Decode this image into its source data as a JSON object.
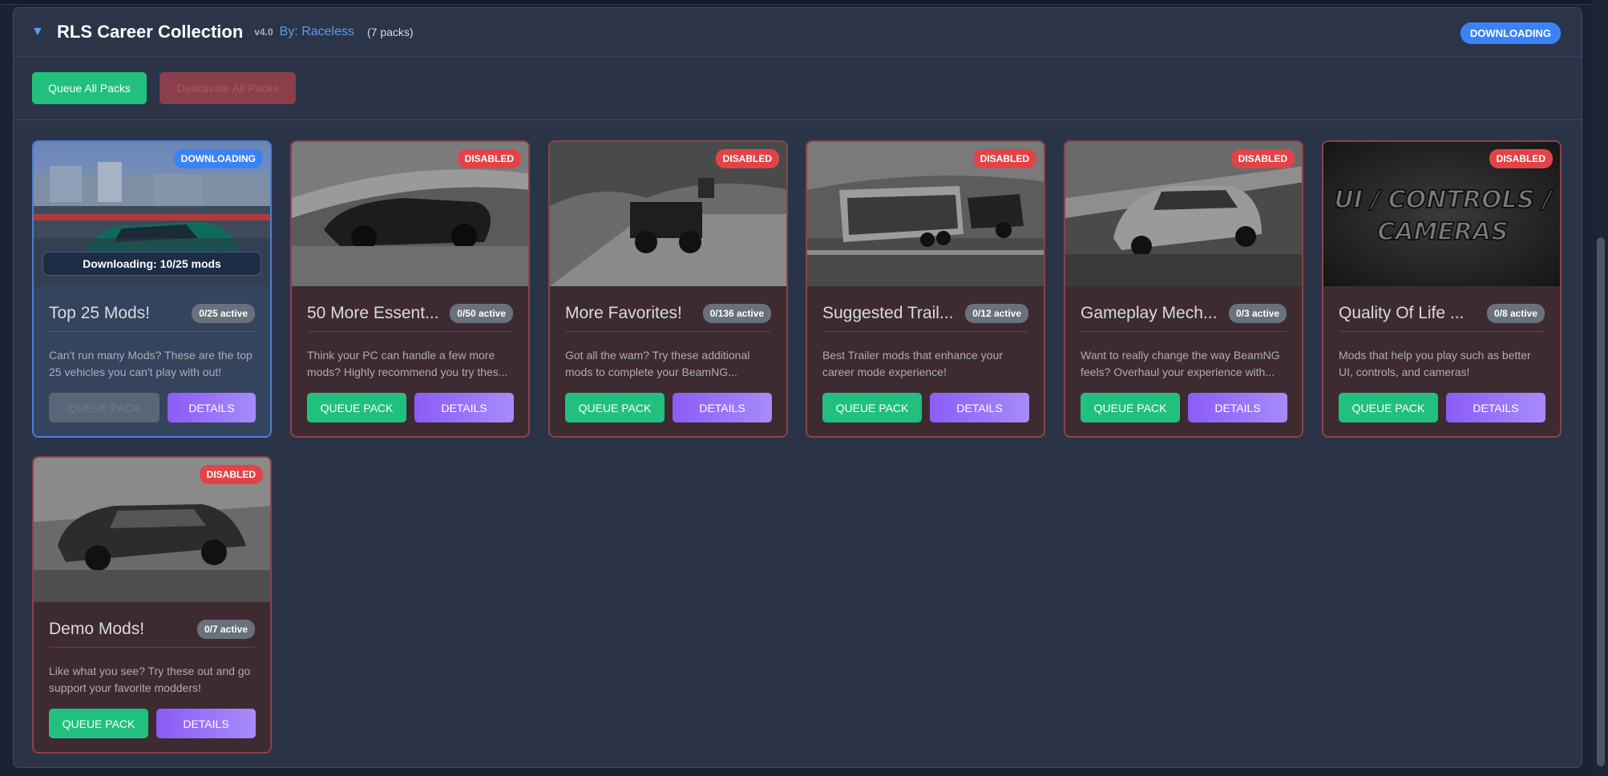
{
  "collection": {
    "title": "RLS Career Collection",
    "version": "v4.0",
    "author": "By: Raceless",
    "pack_count": "(7 packs)",
    "status": "DOWNLOADING"
  },
  "toolbar": {
    "queue_all_label": "Queue All Packs",
    "deactivate_all_label": "Deactivate All Packs"
  },
  "cards": [
    {
      "title": "Top 25 Mods!",
      "active": "0/25 active",
      "status": "DOWNLOADING",
      "description": "Can't run many Mods? These are the top 25 vehicles you can't play with out!",
      "progress_text": "Downloading: 10/25 mods",
      "queue_label": "QUEUE PACK",
      "details_label": "DETAILS"
    },
    {
      "title": "50 More Essent...",
      "active": "0/50 active",
      "status": "DISABLED",
      "description": "Think your PC can handle a few more mods? Highly recommend you try thes...",
      "queue_label": "QUEUE PACK",
      "details_label": "DETAILS"
    },
    {
      "title": "More Favorites!",
      "active": "0/136 active",
      "status": "DISABLED",
      "description": "Got all the wam? Try these additional mods to complete your BeamNG...",
      "queue_label": "QUEUE PACK",
      "details_label": "DETAILS"
    },
    {
      "title": "Suggested Trail...",
      "active": "0/12 active",
      "status": "DISABLED",
      "description": "Best Trailer mods that enhance your career mode experience!",
      "queue_label": "QUEUE PACK",
      "details_label": "DETAILS"
    },
    {
      "title": "Gameplay Mech...",
      "active": "0/3 active",
      "status": "DISABLED",
      "description": "Want to really change the way BeamNG feels? Overhaul your experience with...",
      "queue_label": "QUEUE PACK",
      "details_label": "DETAILS"
    },
    {
      "title": "Quality Of Life ...",
      "active": "0/8 active",
      "status": "DISABLED",
      "description": "Mods that help you play such as better UI, controls, and cameras!",
      "thumb_text_line1": "UI / CONTROLS /",
      "thumb_text_line2": "CAMERAS",
      "queue_label": "QUEUE PACK",
      "details_label": "DETAILS"
    },
    {
      "title": "Demo Mods!",
      "active": "0/7 active",
      "status": "DISABLED",
      "description": "Like what you see? Try these out and go support your favorite modders!",
      "queue_label": "QUEUE PACK",
      "details_label": "DETAILS"
    }
  ]
}
